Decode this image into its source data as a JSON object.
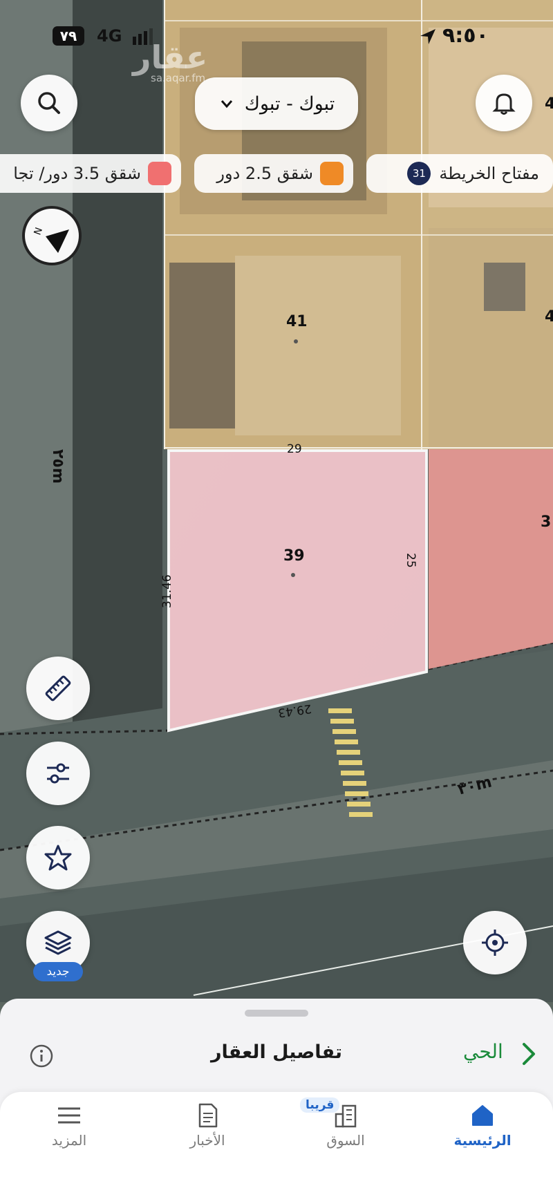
{
  "status_bar": {
    "time": "٩:٥٠",
    "network": "4G",
    "battery": "٧٩"
  },
  "watermark": {
    "logo": "عقار",
    "site": "sa.aqar.fm"
  },
  "top": {
    "location_selector": "تبوك - تبوك",
    "search_icon": "search-icon",
    "notification_icon": "bell-icon"
  },
  "legend": {
    "map_key_label": "مفتاح الخريطة",
    "map_key_count": "31",
    "items": [
      {
        "label": "شقق 2.5 دور",
        "color": "#ef8a26"
      },
      {
        "label": "شقق 3.5 دور/ تجا",
        "color": "#f07070"
      }
    ]
  },
  "map": {
    "street_width_west": "٢٥m",
    "street_width_south": "٣٠m",
    "parcels": [
      {
        "number": "41"
      },
      {
        "number": "39"
      }
    ],
    "edge_partial_labels": [
      "4",
      "4",
      "3"
    ],
    "dimensions": {
      "top": "29",
      "right": "25",
      "left": "31.46",
      "bottom": "29.43"
    },
    "colors": {
      "parcel_selected_fill": "#f2c6cc",
      "parcel_neighbor_fill": "#e99a95",
      "parcel_outline": "#ffffff"
    }
  },
  "controls": {
    "ruler_icon": "ruler-icon",
    "filter_icon": "sliders-icon",
    "favorite_icon": "star-icon",
    "layers_icon": "layers-icon",
    "layers_badge": "جديد",
    "locate_icon": "crosshair-icon"
  },
  "sheet": {
    "title": "تفاصيل العقار",
    "district_link": "الحي",
    "accent": "#1a8a3a"
  },
  "tabbar": {
    "tabs": [
      {
        "label": "الرئيسية",
        "active": true
      },
      {
        "label": "السوق",
        "badge": "قريبا"
      },
      {
        "label": "الأخبار"
      },
      {
        "label": "المزيد"
      }
    ],
    "active_color": "#1f63c6"
  }
}
